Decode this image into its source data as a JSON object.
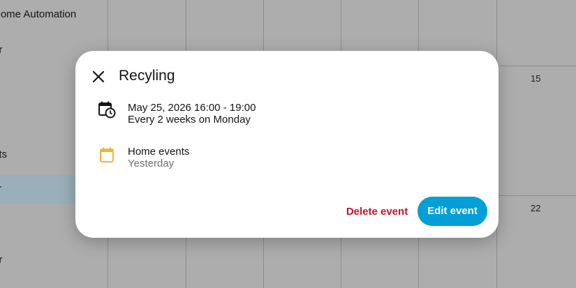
{
  "background": {
    "sidebar_items": [
      "Home Automation",
      "or",
      "ets",
      "r",
      "er"
    ],
    "day_numbers": [
      "15",
      "22"
    ]
  },
  "dialog": {
    "title": "Recyling",
    "close_icon": "close-icon",
    "when": {
      "icon": "calendar-clock-icon",
      "datetime": "May 25, 2026 16:00 - 19:00",
      "recurrence": "Every 2 weeks on Monday"
    },
    "calendar": {
      "icon": "calendar-icon",
      "name": "Home events",
      "relative": "Yesterday",
      "color": "#f0b43c"
    },
    "delete_label": "Delete event",
    "edit_label": "Edit event"
  },
  "colors": {
    "accent": "#039fd6",
    "danger": "#c8102e"
  }
}
